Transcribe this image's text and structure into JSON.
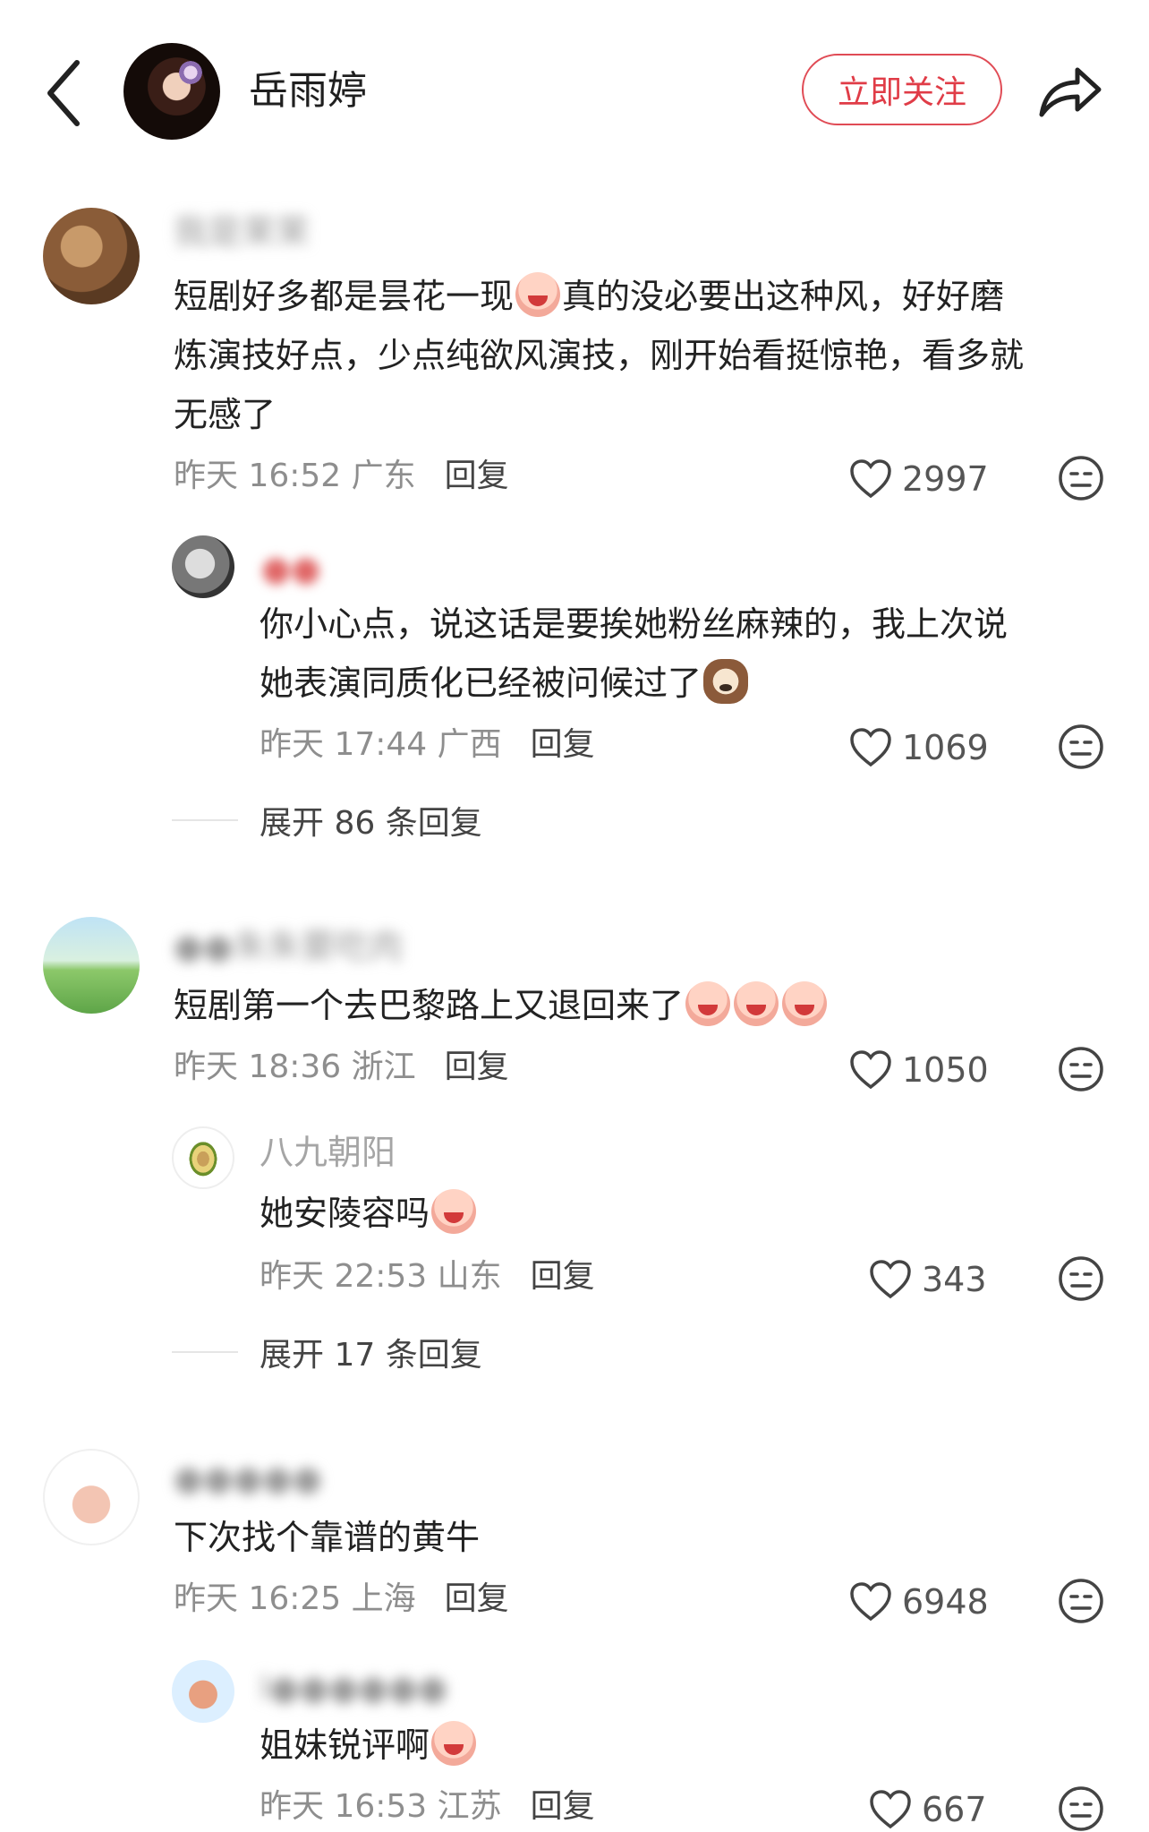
{
  "header": {
    "title": "岳雨婷",
    "follow_label": "立即关注"
  },
  "comments": [
    {
      "text_lines": [
        "短剧好多都是昙花一现",
        "真的没必要出这种风，好好磨",
        "炼演技好点，少点纯欲风演技，刚开始看挺惊艳，看多就",
        "无感了"
      ],
      "time": "昨天 16:52",
      "location": "广东",
      "reply_label": "回复",
      "likes": "2997",
      "replies": [
        {
          "text_lines": [
            "你小心点，说这话是要挨她粉丝麻辣的，我上次说",
            "她表演同质化已经被问候过了"
          ],
          "time": "昨天 17:44",
          "location": "广西",
          "reply_label": "回复",
          "likes": "1069"
        }
      ],
      "expand_label": "展开 86 条回复"
    },
    {
      "text_lines": [
        "短剧第一个去巴黎路上又退回来了"
      ],
      "time": "昨天 18:36",
      "location": "浙江",
      "reply_label": "回复",
      "likes": "1050",
      "replies": [
        {
          "username": "八九朝阳",
          "text_lines": [
            "她安陵容吗"
          ],
          "time": "昨天 22:53",
          "location": "山东",
          "reply_label": "回复",
          "likes": "343"
        }
      ],
      "expand_label": "展开 17 条回复"
    },
    {
      "text_lines": [
        "下次找个靠谱的黄牛"
      ],
      "time": "昨天 16:25",
      "location": "上海",
      "reply_label": "回复",
      "likes": "6948",
      "replies": [
        {
          "text_lines": [
            "姐妹锐评啊"
          ],
          "time": "昨天 16:53",
          "location": "江苏",
          "reply_label": "回复",
          "likes": "667"
        }
      ]
    }
  ],
  "colors": {
    "accent": "#e03c47",
    "meta": "#8e8e8e"
  },
  "icons": [
    "back-chevron-icon",
    "share-arrow-icon",
    "heart-icon",
    "dislike-face-icon",
    "emoji-icon"
  ]
}
